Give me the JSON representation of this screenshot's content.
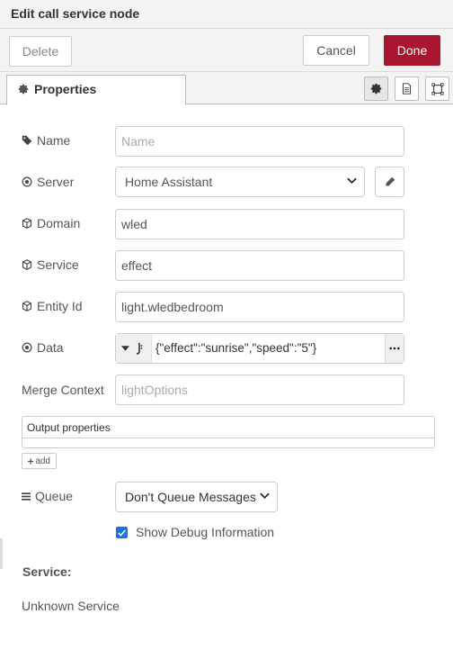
{
  "titlebar": {
    "title": "Edit call service node"
  },
  "toolbar": {
    "delete_label": "Delete",
    "cancel_label": "Cancel",
    "done_label": "Done"
  },
  "tabs": {
    "properties_label": "Properties",
    "icons": [
      "gear-icon",
      "document-icon",
      "frame-icon"
    ]
  },
  "form": {
    "name": {
      "label": "Name",
      "value": "",
      "placeholder": "Name"
    },
    "server": {
      "label": "Server",
      "value": "Home Assistant"
    },
    "domain": {
      "label": "Domain",
      "value": "wled"
    },
    "service": {
      "label": "Service",
      "value": "effect"
    },
    "entity_id": {
      "label": "Entity Id",
      "value": "light.wledbedroom"
    },
    "data": {
      "label": "Data",
      "value": "{\"effect\":\"sunrise\",\"speed\":\"5\"}"
    },
    "merge_context": {
      "label": "Merge Context",
      "value": "",
      "placeholder": "lightOptions"
    },
    "output_properties": {
      "label": "Output properties",
      "add_label": "add"
    },
    "queue": {
      "label": "Queue",
      "value": "Don't Queue Messages"
    },
    "debug": {
      "label": "Show Debug Information",
      "checked": true
    }
  },
  "service_info": {
    "title": "Service:",
    "value": "Unknown Service"
  },
  "colors": {
    "accent": "#a9152f",
    "checkbox": "#1a73e8"
  }
}
